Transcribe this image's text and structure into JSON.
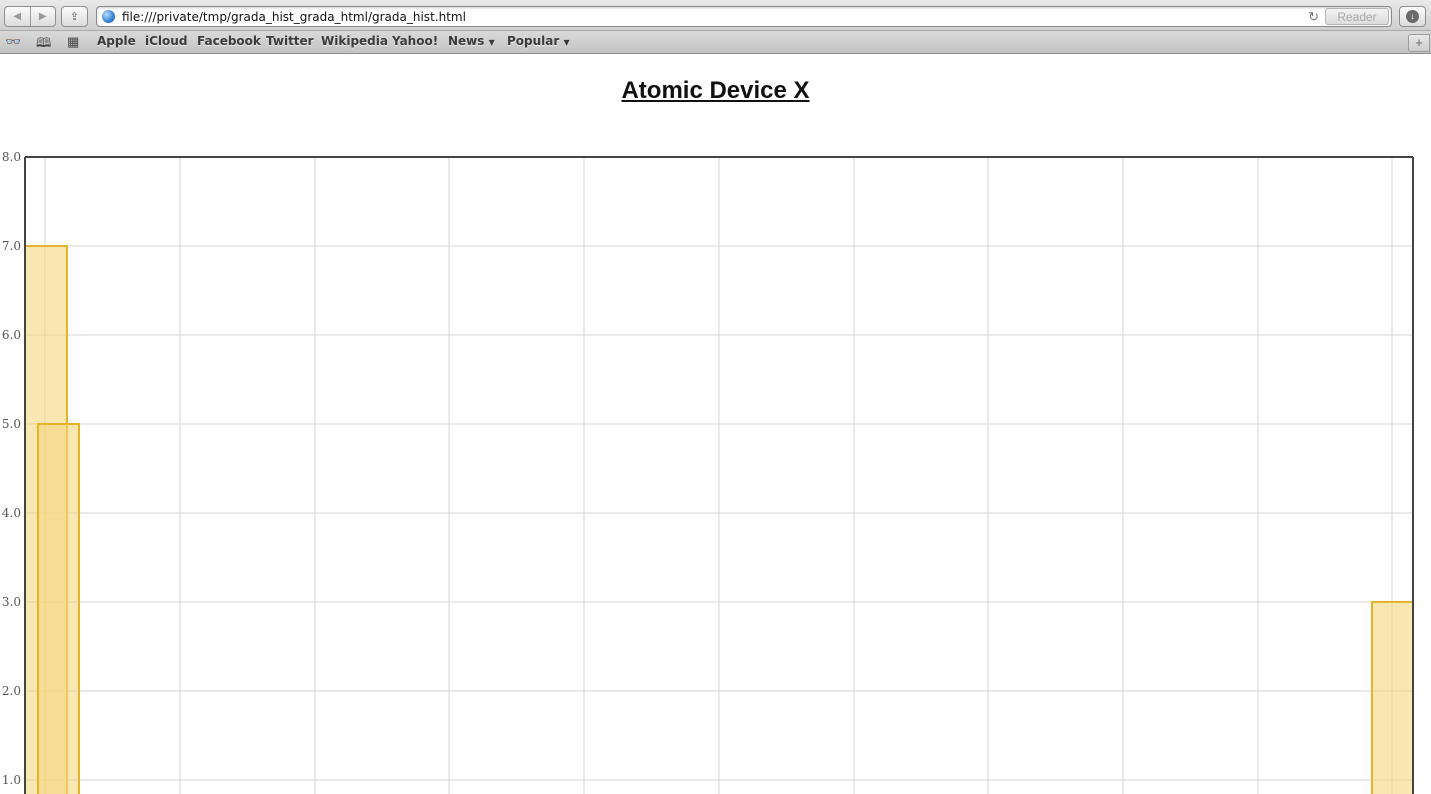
{
  "browser": {
    "url": "file:///private/tmp/grada_hist_grada_html/grada_hist.html",
    "reader_label": "Reader",
    "bookmarks": [
      "Apple",
      "iCloud",
      "Facebook",
      "Twitter",
      "Wikipedia",
      "Yahoo!",
      "News",
      "Popular"
    ]
  },
  "page": {
    "title": "Atomic Device X"
  },
  "chart_data": {
    "type": "bar",
    "title": "Atomic Device X",
    "xlabel": "",
    "ylabel": "",
    "ylim": [
      0.8,
      8.0
    ],
    "yticks": [
      "8.0",
      "7.0",
      "6.0",
      "5.0",
      "4.0",
      "3.0",
      "2.0",
      "1.0"
    ],
    "grid": true,
    "series": [
      {
        "values": [
          7,
          5,
          3
        ]
      }
    ],
    "colors": {
      "bar_fill": "#f5d77f",
      "bar_stroke": "#e6b32a",
      "grid": "#d4d4d4",
      "frame": "#444444"
    }
  }
}
